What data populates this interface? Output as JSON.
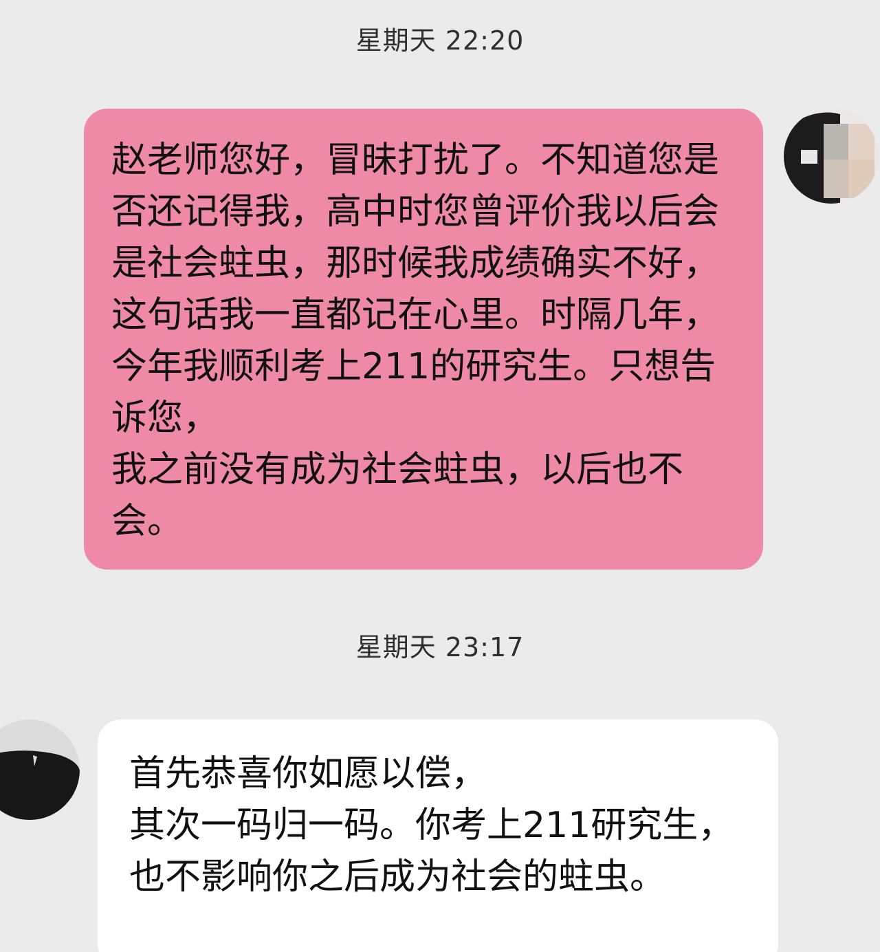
{
  "conversation": {
    "messages": [
      {
        "timestamp": "星期天 22:20",
        "sender": "me",
        "text": "赵老师您好，冒昧打扰了。不知道您是否还记得我，高中时您曾评价我以后会是社会蛀虫，那时候我成绩确实不好，这句话我一直都记在心里。时隔几年，今年我顺利考上211的研究生。只想告诉您，\n我之前没有成为社会蛀虫，以后也不会。"
      },
      {
        "timestamp": "星期天 23:17",
        "sender": "teacher",
        "text": "首先恭喜你如愿以偿，\n其次一码归一码。你考上211研究生，\n也不影响你之后成为社会的蛀虫。"
      }
    ]
  },
  "colors": {
    "background": "#ebebeb",
    "sent_bubble": "#ee8aa6",
    "received_bubble": "#ffffff",
    "text": "#111111",
    "timestamp_text": "#2f2f2f"
  },
  "icons": {
    "my_avatar": "blurred-person-avatar-icon",
    "teacher_avatar": "dark-silhouette-avatar-icon"
  }
}
